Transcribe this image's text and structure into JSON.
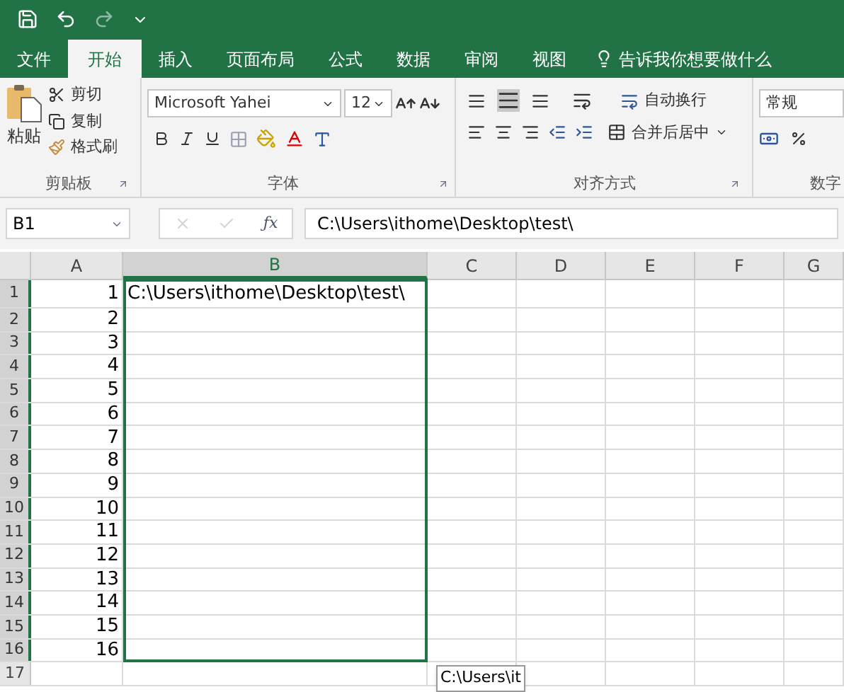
{
  "tabs": [
    {
      "label": "文件",
      "selected": false
    },
    {
      "label": "开始",
      "selected": true
    },
    {
      "label": "插入",
      "selected": false
    },
    {
      "label": "页面布局",
      "selected": false
    },
    {
      "label": "公式",
      "selected": false
    },
    {
      "label": "数据",
      "selected": false
    },
    {
      "label": "审阅",
      "selected": false
    },
    {
      "label": "视图",
      "selected": false
    }
  ],
  "tell_me": "告诉我你想要做什么",
  "ribbon": {
    "paste": "粘贴",
    "cut": "剪切",
    "copy": "复制",
    "format_painter": "格式刷",
    "clipboard_group": "剪贴板",
    "font_name": "Microsoft Yahei",
    "font_size": "12",
    "font_group": "字体",
    "wrap_text": "自动换行",
    "merge_center": "合并后居中",
    "alignment_group": "对齐方式",
    "number_format": "常规",
    "number_group": "数字"
  },
  "formula_bar": {
    "name_box": "B1",
    "function_button": "ƒx",
    "formula": "C:\\Users\\ithome\\Desktop\\test\\"
  },
  "sheet": {
    "columns": [
      {
        "label": "A",
        "selected": false
      },
      {
        "label": "B",
        "selected": true
      },
      {
        "label": "C",
        "selected": false
      },
      {
        "label": "D",
        "selected": false
      },
      {
        "label": "E",
        "selected": false
      },
      {
        "label": "F",
        "selected": false
      },
      {
        "label": "G",
        "selected": false
      }
    ],
    "rows": [
      {
        "header": "1",
        "selected": true,
        "a": "1",
        "b": "C:\\Users\\ithome\\Desktop\\test\\"
      },
      {
        "header": "2",
        "selected": true,
        "a": "2"
      },
      {
        "header": "3",
        "selected": true,
        "a": "3"
      },
      {
        "header": "4",
        "selected": true,
        "a": "4"
      },
      {
        "header": "5",
        "selected": true,
        "a": "5"
      },
      {
        "header": "6",
        "selected": true,
        "a": "6"
      },
      {
        "header": "7",
        "selected": true,
        "a": "7"
      },
      {
        "header": "8",
        "selected": true,
        "a": "8"
      },
      {
        "header": "9",
        "selected": true,
        "a": "9"
      },
      {
        "header": "10",
        "selected": true,
        "a": "10"
      },
      {
        "header": "11",
        "selected": true,
        "a": "11"
      },
      {
        "header": "12",
        "selected": true,
        "a": "12"
      },
      {
        "header": "13",
        "selected": true,
        "a": "13"
      },
      {
        "header": "14",
        "selected": true,
        "a": "14"
      },
      {
        "header": "15",
        "selected": true,
        "a": "15"
      },
      {
        "header": "16",
        "selected": true,
        "a": "16"
      },
      {
        "header": "17",
        "selected": false
      }
    ],
    "tooltip": "C:\\Users\\it"
  }
}
